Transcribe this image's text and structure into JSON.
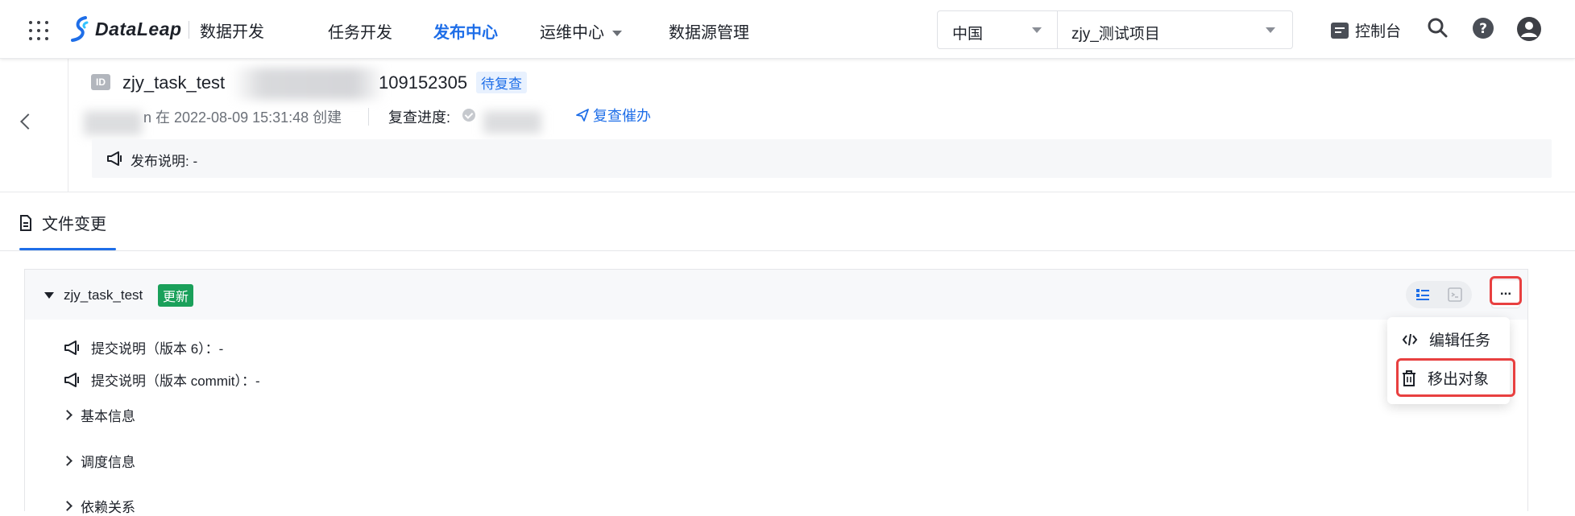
{
  "topbar": {
    "brand": "DataLeap",
    "product": "数据开发",
    "nav": [
      "任务开发",
      "发布中心",
      "运维中心",
      "数据源管理"
    ],
    "active_nav": "发布中心",
    "region": "中国",
    "project": "zjy_测试项目",
    "console_label": "控制台"
  },
  "header": {
    "id_badge": "ID",
    "task_name": "zjy_task_test",
    "task_id_suffix": "109152305",
    "status": "待复查",
    "created_text": "n 在 2022-08-09 15:31:48 创建",
    "review_progress_label": "复查进度:",
    "remind_label": "复查催办",
    "release_note": "发布说明: -"
  },
  "tabs": {
    "file_changes": "文件变更"
  },
  "file": {
    "name": "zjy_task_test",
    "tag": "更新",
    "more_label": "...",
    "notes": [
      "提交说明（版本 6）：-",
      "提交说明（版本 commit）：-"
    ],
    "sections": [
      "基本信息",
      "调度信息",
      "依赖关系"
    ]
  },
  "menu": {
    "items": [
      "编辑任务",
      "移出对象"
    ]
  },
  "colors": {
    "accent": "#1e6ee8",
    "success": "#1aa05a",
    "highlight": "#e84040"
  }
}
